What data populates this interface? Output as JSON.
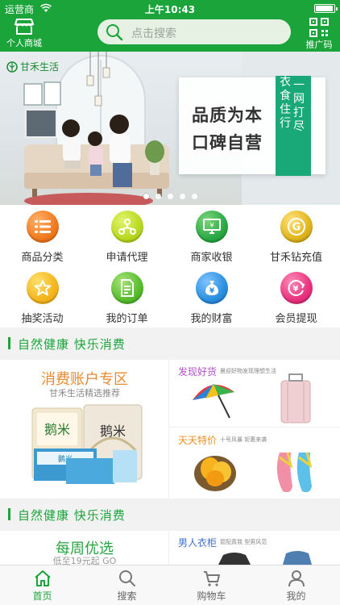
{
  "status_bar": {
    "carrier": "运营商",
    "time": "上午10:43"
  },
  "header": {
    "left_label": "个人商城",
    "search_placeholder": "点击搜索",
    "right_label": "推广码",
    "brand_color": "#1aa43a"
  },
  "banner": {
    "logo_text": "甘禾生活",
    "headline_line1": "品质为本",
    "headline_line2": "口碑自营",
    "strip_col1": "一网打尽",
    "strip_col2": "衣食住行",
    "slide_count": 5,
    "active_slide": 1
  },
  "menu": [
    {
      "label": "商品分类",
      "icon": "list-icon",
      "color": "#f07a1f"
    },
    {
      "label": "申请代理",
      "icon": "network-icon",
      "color": "#9ecb1a"
    },
    {
      "label": "商家收银",
      "icon": "cashier-monitor-icon",
      "color": "#2aa845"
    },
    {
      "label": "甘禾钻充值",
      "icon": "coin-icon",
      "color": "#e0b51d"
    },
    {
      "label": "抽奖活动",
      "icon": "star-icon",
      "color": "#f3b51b"
    },
    {
      "label": "我的订单",
      "icon": "order-document-icon",
      "color": "#58bc2e"
    },
    {
      "label": "我的财富",
      "icon": "money-bag-icon",
      "color": "#2b8fe0"
    },
    {
      "label": "会员提现",
      "icon": "withdraw-icon",
      "color": "#e8337e"
    }
  ],
  "sections": [
    {
      "title": "自然健康  快乐消费"
    },
    {
      "title": "自然健康  快乐消费"
    }
  ],
  "promo1": {
    "left_title": "消费账户专区",
    "left_sub": "甘禾生活精选推荐",
    "right_top_title": "发现好货",
    "right_top_sub": "晨迎好物发现理想生活",
    "right_top_color": "#b44fd0",
    "right_bottom_title": "天天特价",
    "right_bottom_sub": "十号风暴  钜惠来袭",
    "right_bottom_color": "#f08c1e"
  },
  "promo2": {
    "left_title": "每周优选",
    "left_sub": "低至19元起 GO",
    "right_title": "男人衣柜",
    "right_sub": "箭配真我  型男风范",
    "right_color": "#3d6fd0"
  },
  "tabs": [
    {
      "label": "首页",
      "icon": "home-icon",
      "active": true
    },
    {
      "label": "搜索",
      "icon": "search-icon",
      "active": false
    },
    {
      "label": "购物车",
      "icon": "cart-icon",
      "active": false
    },
    {
      "label": "我的",
      "icon": "person-icon",
      "active": false
    }
  ]
}
